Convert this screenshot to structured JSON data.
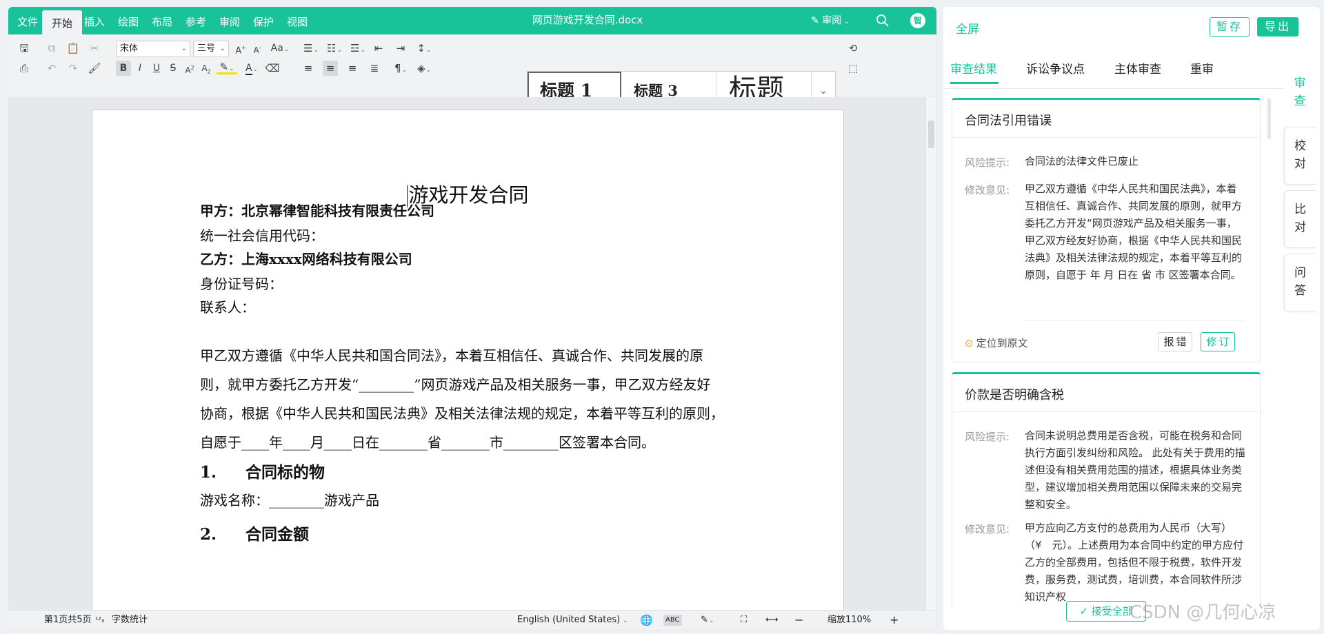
{
  "editor": {
    "menu": [
      "文件",
      "开始",
      "插入",
      "绘图",
      "布局",
      "参考",
      "审阅",
      "保护",
      "视图"
    ],
    "active_menu": "开始",
    "doc_title": "网页游戏开发合同.docx",
    "review_mode": "审阅",
    "avatar": "智",
    "accent": "#19c39a"
  },
  "ribbon": {
    "font_name": "宋体",
    "font_size": "三号",
    "styles": {
      "h1": "标题 1",
      "h3": "标题 3",
      "title": "标题"
    }
  },
  "document": {
    "heading": "游戏开发合同",
    "party_a": "甲方：北京幂律智能科技有限责任公司",
    "credit_code": "统一社会信用代码：",
    "party_b": "乙方：上海xxxx网络科技有限公司",
    "id_number": "身份证号码：",
    "contact": "联系人：",
    "para1": [
      "甲乙双方遵循《中华人民共和国合同法》，本着互相信任、真诚合作、共同发展的原",
      "则，就甲方委托乙方开发“________”网页游戏产品及相关服务一事，甲乙双方经友好",
      "协商，根据《中华人民共和国民法典》及相关法律法规的规定，本着平等互利的原则，",
      "自愿于____年____月____日在_______省_______市________区签署本合同。"
    ],
    "sec1_num": "1.",
    "sec1_title": "合同标的物",
    "game_name": "游戏名称：________游戏产品",
    "sec2_num": "2.",
    "sec2_title": "合同金额"
  },
  "status": {
    "page": "第1页共5页",
    "word_count": "字数统计",
    "language": "English (United States)",
    "zoom": "缩放110%"
  },
  "panel": {
    "fullscreen": "全屏",
    "save_draft": "暂存",
    "export": "导出",
    "tabs": [
      "审查结果",
      "诉讼争议点",
      "主体审查",
      "重审"
    ],
    "side_tabs": [
      [
        "审",
        "查"
      ],
      [
        "校",
        "对"
      ],
      [
        "比",
        "对"
      ],
      [
        "问",
        "答"
      ]
    ],
    "cards": [
      {
        "title": "合同法引用错误",
        "risk_label": "风险提示:",
        "risk": "合同法的法律文件已废止",
        "suggest_label": "修改意见:",
        "suggest": "甲乙双方遵循《中华人民共和国民法典》，本着互相信任、真诚合作、共同发展的原则，就甲方委托乙方开发“网页游戏产品及相关服务一事，甲乙双方经友好协商，根据《中华人民共和国民法典》及相关法律法规的规定，本着平等互利的原则，自愿于 年 月 日在 省 市 区签署本合同。",
        "locate": "定位到原文",
        "report": "报错",
        "revise": "修订"
      },
      {
        "title": "价款是否明确含税",
        "risk_label": "风险提示:",
        "risk": "合同未说明总费用是否含税，可能在税务和合同执行方面引发纠纷和风险。 此处有关于费用的描述但没有相关费用范围的描述，根据具体业务类型，建议增加相关费用范围以保障未来的交易完整和安全。",
        "suggest_label": "修改意见:",
        "suggest": "甲方应向乙方支付的总费用为人民币（大写）　　（¥　元）。上述费用为本合同中约定的甲方应付乙方的全部费用，包括但不限于税费，软件开发费，服务费，测试费，培训费，本合同软件所涉知识产权"
      }
    ],
    "accept_all": "接受全部",
    "watermark": "CSDN @几何心凉"
  }
}
